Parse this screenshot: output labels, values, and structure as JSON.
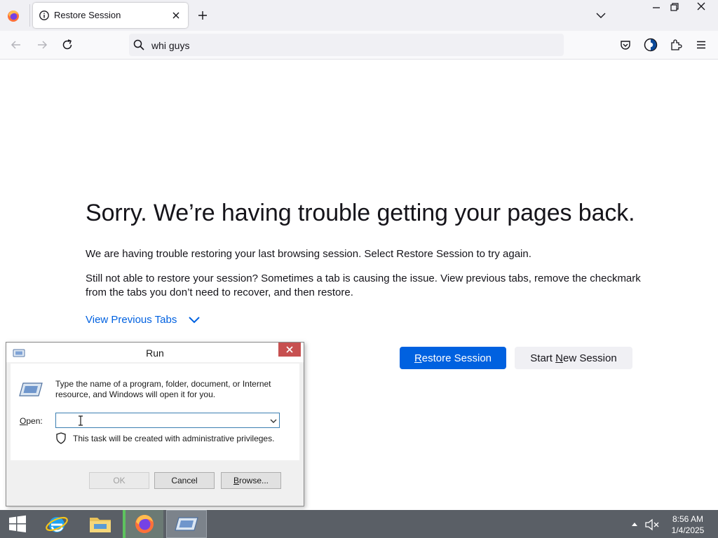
{
  "browser": {
    "tab": {
      "title": "Restore Session"
    },
    "url": {
      "value": "whi guys"
    }
  },
  "page": {
    "title": "Sorry. We’re having trouble getting your pages back.",
    "paragraph1": "We are having trouble restoring your last browsing session. Select Restore Session to try again.",
    "paragraph2": "Still not able to restore your session? Sometimes a tab is causing the issue. View previous tabs, remove the checkmark from the tabs you don’t need to recover, and then restore.",
    "view_previous_tabs": "View Previous Tabs",
    "restore_button": {
      "mnemonic": "R",
      "rest": "estore Session"
    },
    "new_session_button": {
      "before": "Start ",
      "mnemonic": "N",
      "after": "ew Session"
    }
  },
  "run_dialog": {
    "title": "Run",
    "description": "Type the name of a program, folder, document, or Internet resource, and Windows will open it for you.",
    "open_label": {
      "mnemonic": "O",
      "rest": "pen:"
    },
    "open_value": "",
    "admin_note": "This task will be created with administrative privileges.",
    "ok_label": "OK",
    "cancel_label": "Cancel",
    "browse_label": {
      "mnemonic": "B",
      "rest": "rowse..."
    }
  },
  "taskbar": {
    "clock": {
      "time": "8:56 AM",
      "date": "1/4/2025"
    }
  },
  "colors": {
    "accent": "#0061e0",
    "taskbar": "#5a5f66",
    "close_red": "#c75050"
  }
}
